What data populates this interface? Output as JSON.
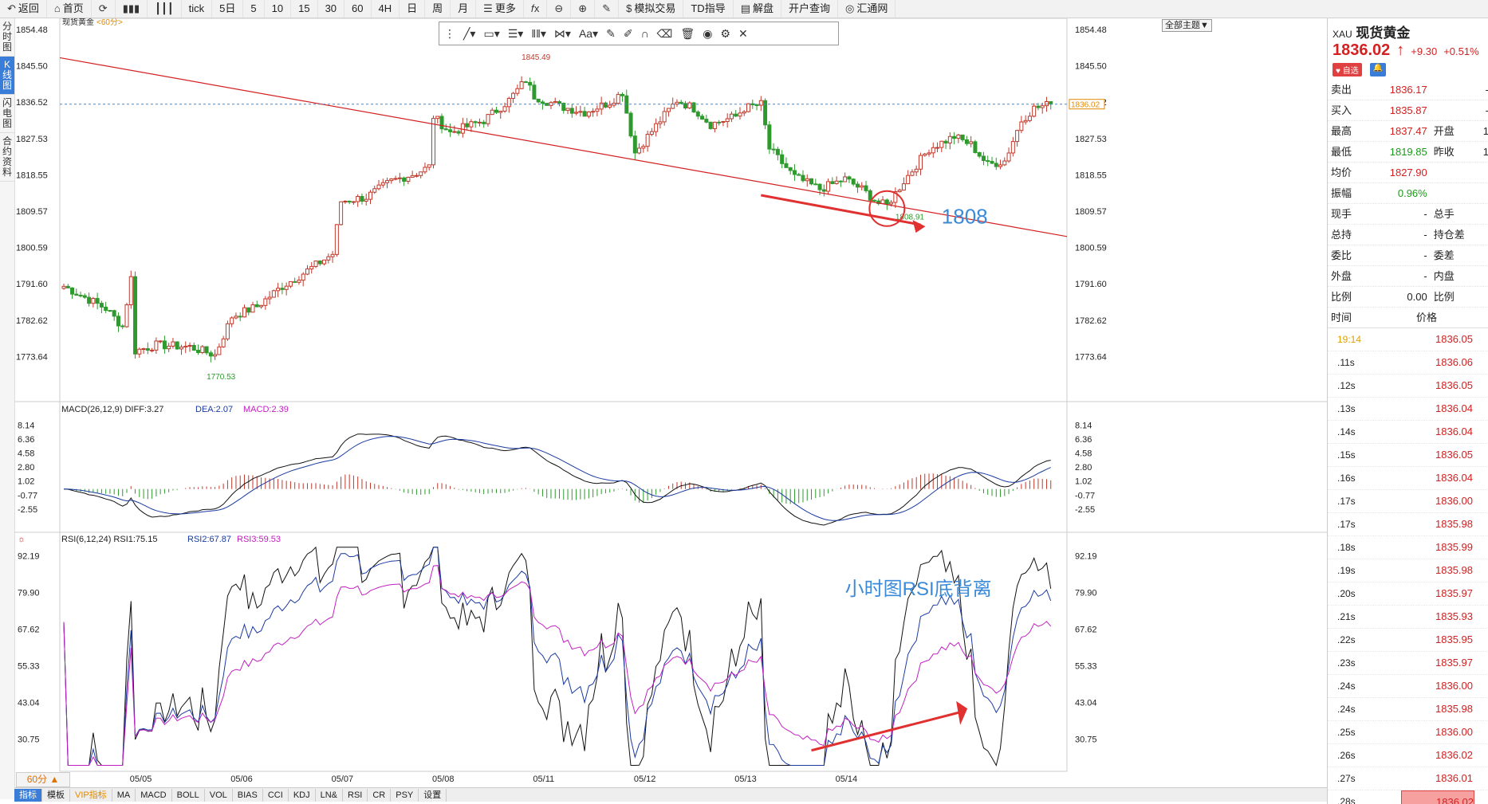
{
  "toolbar": {
    "items": [
      {
        "icon": "back-arrow-icon",
        "label": "返回"
      },
      {
        "icon": "home-icon",
        "label": "首页"
      },
      {
        "icon": "refresh-icon",
        "label": ""
      },
      {
        "icon": "bar-chart-icon",
        "label": ""
      },
      {
        "icon": "candle-icon",
        "label": ""
      },
      {
        "icon": "",
        "label": "tick"
      },
      {
        "icon": "",
        "label": "5日"
      },
      {
        "icon": "",
        "label": "5"
      },
      {
        "icon": "",
        "label": "10"
      },
      {
        "icon": "",
        "label": "15"
      },
      {
        "icon": "",
        "label": "30"
      },
      {
        "icon": "",
        "label": "60"
      },
      {
        "icon": "",
        "label": "4H"
      },
      {
        "icon": "",
        "label": "日"
      },
      {
        "icon": "",
        "label": "周"
      },
      {
        "icon": "",
        "label": "月"
      },
      {
        "icon": "list-icon",
        "label": "更多"
      },
      {
        "icon": "fx-icon",
        "label": ""
      },
      {
        "icon": "zoom-out-icon",
        "label": ""
      },
      {
        "icon": "zoom-in-icon",
        "label": ""
      },
      {
        "icon": "pen-icon",
        "label": ""
      },
      {
        "icon": "dollar-icon",
        "label": "模拟交易"
      },
      {
        "icon": "",
        "label": "TD指导"
      },
      {
        "icon": "book-icon",
        "label": "解盘"
      },
      {
        "icon": "",
        "label": "开户查询"
      },
      {
        "icon": "globe-icon",
        "label": "汇通网"
      }
    ]
  },
  "left_tabs": [
    "分时图",
    "K线图",
    "闪电图",
    "合约资料"
  ],
  "theme_button": "全部主题▼",
  "chart_data": {
    "type": "candlestick",
    "title": "现货黄金",
    "period": "<60分>",
    "x_labels": [
      "05/05",
      "05/06",
      "05/07",
      "05/08",
      "05/11",
      "05/12",
      "05/13",
      "05/14"
    ],
    "ylim": [
      1764.65,
      1854.48
    ],
    "y_ticks": [
      "1854.48",
      "1845.50",
      "1836.52",
      "1827.53",
      "1818.55",
      "1809.57",
      "1800.59",
      "1791.60",
      "1782.62",
      "1773.64"
    ],
    "current_price_label": "1836.02",
    "current_price": 1836.02,
    "annotations": {
      "high": "1845.49",
      "low": "1770.53",
      "recent_low": "1808.91",
      "big_label": "1808",
      "rsi_note": "小时图RSI底背离"
    },
    "waypoints": [
      [
        0,
        1791.0
      ],
      [
        10,
        1785.5
      ],
      [
        14,
        1781.0
      ],
      [
        16,
        1793.0
      ],
      [
        17,
        1775.0
      ],
      [
        22,
        1776.5
      ],
      [
        30,
        1776.0
      ],
      [
        36,
        1774.0
      ],
      [
        40,
        1783.5
      ],
      [
        46,
        1786.0
      ],
      [
        52,
        1791.0
      ],
      [
        56,
        1793.5
      ],
      [
        64,
        1799.0
      ],
      [
        66,
        1812.0
      ],
      [
        72,
        1813.0
      ],
      [
        78,
        1817.0
      ],
      [
        84,
        1819.0
      ],
      [
        87,
        1820.5
      ],
      [
        88,
        1833.0
      ],
      [
        92,
        1829.0
      ],
      [
        100,
        1832.0
      ],
      [
        106,
        1837.0
      ],
      [
        110,
        1842.0
      ],
      [
        112,
        1838.0
      ],
      [
        118,
        1835.5
      ],
      [
        124,
        1834.0
      ],
      [
        130,
        1836.5
      ],
      [
        133,
        1839.0
      ],
      [
        136,
        1824.0
      ],
      [
        142,
        1832.0
      ],
      [
        146,
        1837.0
      ],
      [
        150,
        1835.0
      ],
      [
        154,
        1831.0
      ],
      [
        160,
        1833.0
      ],
      [
        162,
        1835.0
      ],
      [
        166,
        1836.0
      ],
      [
        168,
        1825.0
      ],
      [
        174,
        1818.0
      ],
      [
        180,
        1815.0
      ],
      [
        186,
        1817.5
      ],
      [
        190,
        1815.0
      ],
      [
        194,
        1811.5
      ],
      [
        196,
        1811.0
      ],
      [
        200,
        1817.0
      ],
      [
        206,
        1825.0
      ],
      [
        212,
        1828.0
      ],
      [
        216,
        1826.0
      ],
      [
        220,
        1821.0
      ],
      [
        224,
        1822.0
      ],
      [
        228,
        1832.0
      ],
      [
        231,
        1835.0
      ],
      [
        235,
        1836.02
      ]
    ],
    "macd": {
      "label": "MACD(26,12,9) DIFF:3.27",
      "dea_label": "DEA:2.07",
      "macd_label": "MACD:2.39",
      "ylim": [
        -5,
        9.5
      ],
      "y_ticks": [
        "8.14",
        "6.36",
        "4.58",
        "2.80",
        "1.02",
        "-0.77",
        "-2.55"
      ]
    },
    "rsi": {
      "label": "RSI(6,12,24) RSI1:75.15",
      "rsi2_label": "RSI2:67.87",
      "rsi3_label": "RSI3:59.53",
      "ylim": [
        20,
        96
      ],
      "y_ticks": [
        "92.19",
        "79.90",
        "67.62",
        "55.33",
        "43.04",
        "30.75"
      ]
    }
  },
  "period_box": "60分 ▲",
  "bottom_tabs": [
    "指标",
    "模板",
    "VIP指标",
    "MA",
    "MACD",
    "BOLL",
    "VOL",
    "BIAS",
    "CCI",
    "KDJ",
    "LN&",
    "RSI",
    "CR",
    "PSY",
    "设置"
  ],
  "quote": {
    "symbol": "XAU",
    "name": "现货黄金",
    "price": "1836.02",
    "arrow": "↑",
    "change": "+9.30",
    "change_pct": "+0.51%",
    "badge1": "自选",
    "rows": [
      {
        "k": "卖出",
        "v": "1836.17",
        "k2": "",
        "v2": "-",
        "color": "red"
      },
      {
        "k": "买入",
        "v": "1835.87",
        "k2": "",
        "v2": "-",
        "color": "red"
      },
      {
        "k": "最高",
        "v": "1837.47",
        "k2": "开盘",
        "v2": "1",
        "color": "red"
      },
      {
        "k": "最低",
        "v": "1819.85",
        "k2": "昨收",
        "v2": "1",
        "color": "green"
      },
      {
        "k": "均价",
        "v": "1827.90",
        "k2": "",
        "v2": "",
        "color": "red"
      },
      {
        "k": "振幅",
        "v": "0.96%",
        "k2": "",
        "v2": "",
        "color": "green"
      },
      {
        "k": "现手",
        "v": "-",
        "k2": "总手",
        "v2": "",
        "color": ""
      },
      {
        "k": "总持",
        "v": "-",
        "k2": "持仓差",
        "v2": "",
        "color": ""
      },
      {
        "k": "委比",
        "v": "-",
        "k2": "委差",
        "v2": "",
        "color": ""
      },
      {
        "k": "外盘",
        "v": "-",
        "k2": "内盘",
        "v2": "",
        "color": ""
      },
      {
        "k": "比例",
        "v": "0.00",
        "k2": "比例",
        "v2": "",
        "color": ""
      }
    ],
    "ticks_header": [
      "时间",
      "价格"
    ],
    "ticks": [
      {
        "t": "19:14",
        "p": "1836.05"
      },
      {
        "t": ".11s",
        "p": "1836.06"
      },
      {
        "t": ".12s",
        "p": "1836.05"
      },
      {
        "t": ".13s",
        "p": "1836.04"
      },
      {
        "t": ".14s",
        "p": "1836.04"
      },
      {
        "t": ".15s",
        "p": "1836.05"
      },
      {
        "t": ".16s",
        "p": "1836.04"
      },
      {
        "t": ".17s",
        "p": "1836.00"
      },
      {
        "t": ".17s",
        "p": "1835.98"
      },
      {
        "t": ".18s",
        "p": "1835.99"
      },
      {
        "t": ".19s",
        "p": "1835.98"
      },
      {
        "t": ".20s",
        "p": "1835.97"
      },
      {
        "t": ".21s",
        "p": "1835.93"
      },
      {
        "t": ".22s",
        "p": "1835.95"
      },
      {
        "t": ".23s",
        "p": "1835.97"
      },
      {
        "t": ".24s",
        "p": "1836.00"
      },
      {
        "t": ".24s",
        "p": "1835.98"
      },
      {
        "t": ".25s",
        "p": "1836.00"
      },
      {
        "t": ".26s",
        "p": "1836.02"
      },
      {
        "t": ".27s",
        "p": "1836.01"
      },
      {
        "t": ".28s",
        "p": "1836.02"
      }
    ]
  }
}
